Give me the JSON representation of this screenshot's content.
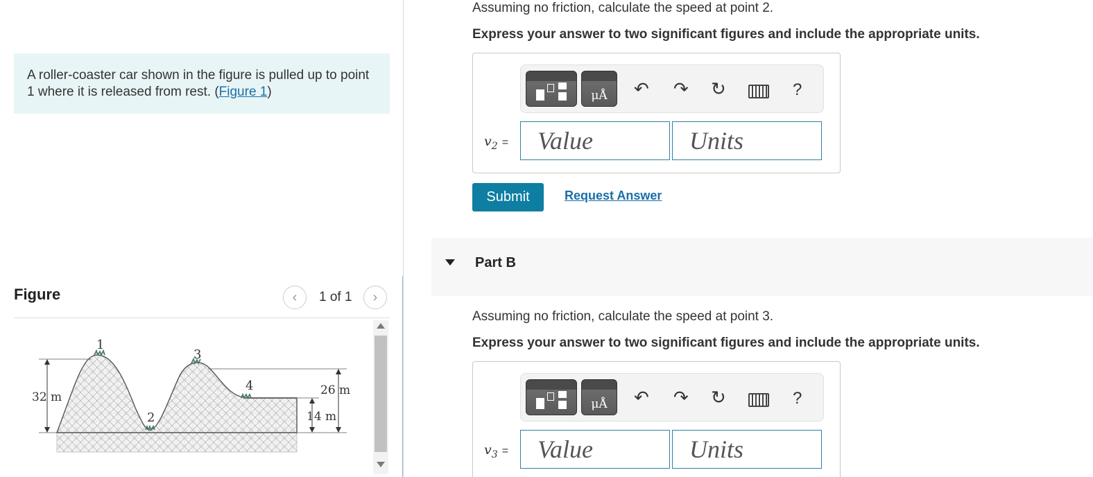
{
  "left": {
    "intro_text": "A roller-coaster car shown in the figure is pulled up to point 1 where it is released from rest. (",
    "intro_link": "Figure 1",
    "intro_end": ")",
    "figure_title": "Figure",
    "page_indicator": "1 of 1",
    "prev_icon": "chevron-left-icon",
    "next_icon": "chevron-right-icon",
    "figure_labels": {
      "p1": "1",
      "p2": "2",
      "p3": "3",
      "p4": "4",
      "h1": "32 m",
      "h3": "26 m",
      "h4": "14 m"
    }
  },
  "partA": {
    "question": "Assuming no friction, calculate the speed at point 2.",
    "instruction": "Express your answer to two significant figures and include the appropriate units.",
    "unit_button": "μÅ",
    "var_symbol": "v",
    "var_sub": "2",
    "var_eq": "=",
    "value_placeholder": "Value",
    "units_placeholder": "Units",
    "help": "?",
    "submit": "Submit",
    "request": "Request Answer"
  },
  "partB": {
    "label": "Part B",
    "question": "Assuming no friction, calculate the speed at point 3.",
    "instruction": "Express your answer to two significant figures and include the appropriate units.",
    "unit_button": "μÅ",
    "var_symbol": "v",
    "var_sub": "3",
    "var_eq": "=",
    "value_placeholder": "Value",
    "units_placeholder": "Units",
    "help": "?"
  },
  "toolbar_icons": [
    "templates-icon",
    "units-icon",
    "undo-icon",
    "redo-icon",
    "reset-icon",
    "keyboard-icon",
    "help-icon"
  ]
}
